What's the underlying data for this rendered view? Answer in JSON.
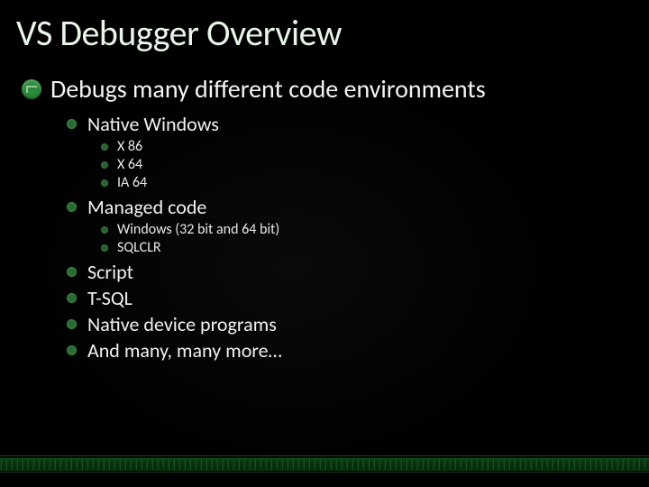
{
  "title": "VS Debugger Overview",
  "bullets": {
    "main": "Debugs many different code environments",
    "sub": [
      {
        "label": "Native Windows",
        "children": [
          "X 86",
          "X 64",
          "IA 64"
        ]
      },
      {
        "label": "Managed code",
        "children": [
          "Windows (32 bit and 64 bit)",
          "SQLCLR"
        ]
      },
      {
        "label": "Script"
      },
      {
        "label": "T-SQL"
      },
      {
        "label": "Native device programs"
      },
      {
        "label": "And many, many more…"
      }
    ]
  }
}
